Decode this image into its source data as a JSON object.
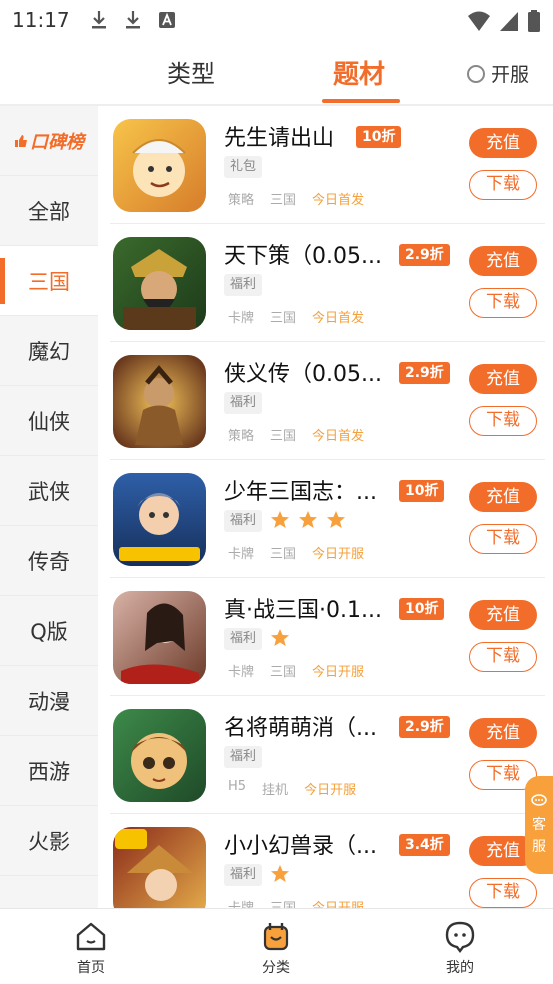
{
  "status": {
    "time": "11:17",
    "icons": [
      "download-icon",
      "download-icon",
      "font-icon"
    ],
    "right_icons": [
      "wifi-icon",
      "signal-icon",
      "battery-icon"
    ]
  },
  "tabs": {
    "type_label": "类型",
    "topic_label": "题材",
    "open_server_label": "开服"
  },
  "sidebar": {
    "brand_label": "口碑榜",
    "items": [
      {
        "label": "全部"
      },
      {
        "label": "三国"
      },
      {
        "label": "魔幻"
      },
      {
        "label": "仙侠"
      },
      {
        "label": "武侠"
      },
      {
        "label": "传奇"
      },
      {
        "label": "Q版"
      },
      {
        "label": "动漫"
      },
      {
        "label": "西游"
      },
      {
        "label": "火影"
      }
    ],
    "active_index": 1
  },
  "games": [
    {
      "name": "先生请出山",
      "discount": "10折",
      "tag": "礼包",
      "stars": 0,
      "meta1": "策略",
      "meta2": "三国",
      "meta3": "今日首发",
      "icon_colors": [
        "#f7c44a",
        "#d77d2b"
      ]
    },
    {
      "name": "天下策（0.05...",
      "discount": "2.9折",
      "tag": "福利",
      "stars": 0,
      "meta1": "卡牌",
      "meta2": "三国",
      "meta3": "今日首发",
      "icon_colors": [
        "#3a6a2c",
        "#c9a23a"
      ]
    },
    {
      "name": "侠义传（0.05...",
      "discount": "2.9折",
      "tag": "福利",
      "stars": 0,
      "meta1": "策略",
      "meta2": "三国",
      "meta3": "今日首发",
      "icon_colors": [
        "#6b3a1e",
        "#e2a53c"
      ]
    },
    {
      "name": "少年三国志：...",
      "discount": "10折",
      "tag": "福利",
      "stars": 3,
      "meta1": "卡牌",
      "meta2": "三国",
      "meta3": "今日开服",
      "icon_colors": [
        "#2f5fa8",
        "#e07a5f"
      ]
    },
    {
      "name": "真·战三国·0.1...",
      "discount": "10折",
      "tag": "福利",
      "stars": 1,
      "meta1": "卡牌",
      "meta2": "三国",
      "meta3": "今日开服",
      "icon_colors": [
        "#b8867a",
        "#6c3b2a"
      ]
    },
    {
      "name": "名将萌萌消（...",
      "discount": "2.9折",
      "tag": "福利",
      "stars": 0,
      "meta1": "H5",
      "meta2": "挂机",
      "meta3": "今日开服",
      "icon_colors": [
        "#3d8a4a",
        "#f0c17a"
      ]
    },
    {
      "name": "小小幻兽录（...",
      "discount": "3.4折",
      "tag": "福利",
      "stars": 1,
      "meta1": "卡牌",
      "meta2": "三国",
      "meta3": "今日开服",
      "icon_colors": [
        "#8a2a1a",
        "#e8b04c"
      ]
    }
  ],
  "buttons": {
    "recharge": "充值",
    "download": "下载"
  },
  "service": {
    "line1": "客",
    "line2": "服"
  },
  "bottom_nav": {
    "home": "首页",
    "category": "分类",
    "mine": "我的"
  },
  "colors": {
    "accent": "#f36d2a",
    "star": "#f7a03c",
    "hot_text": "#f5a03a"
  }
}
